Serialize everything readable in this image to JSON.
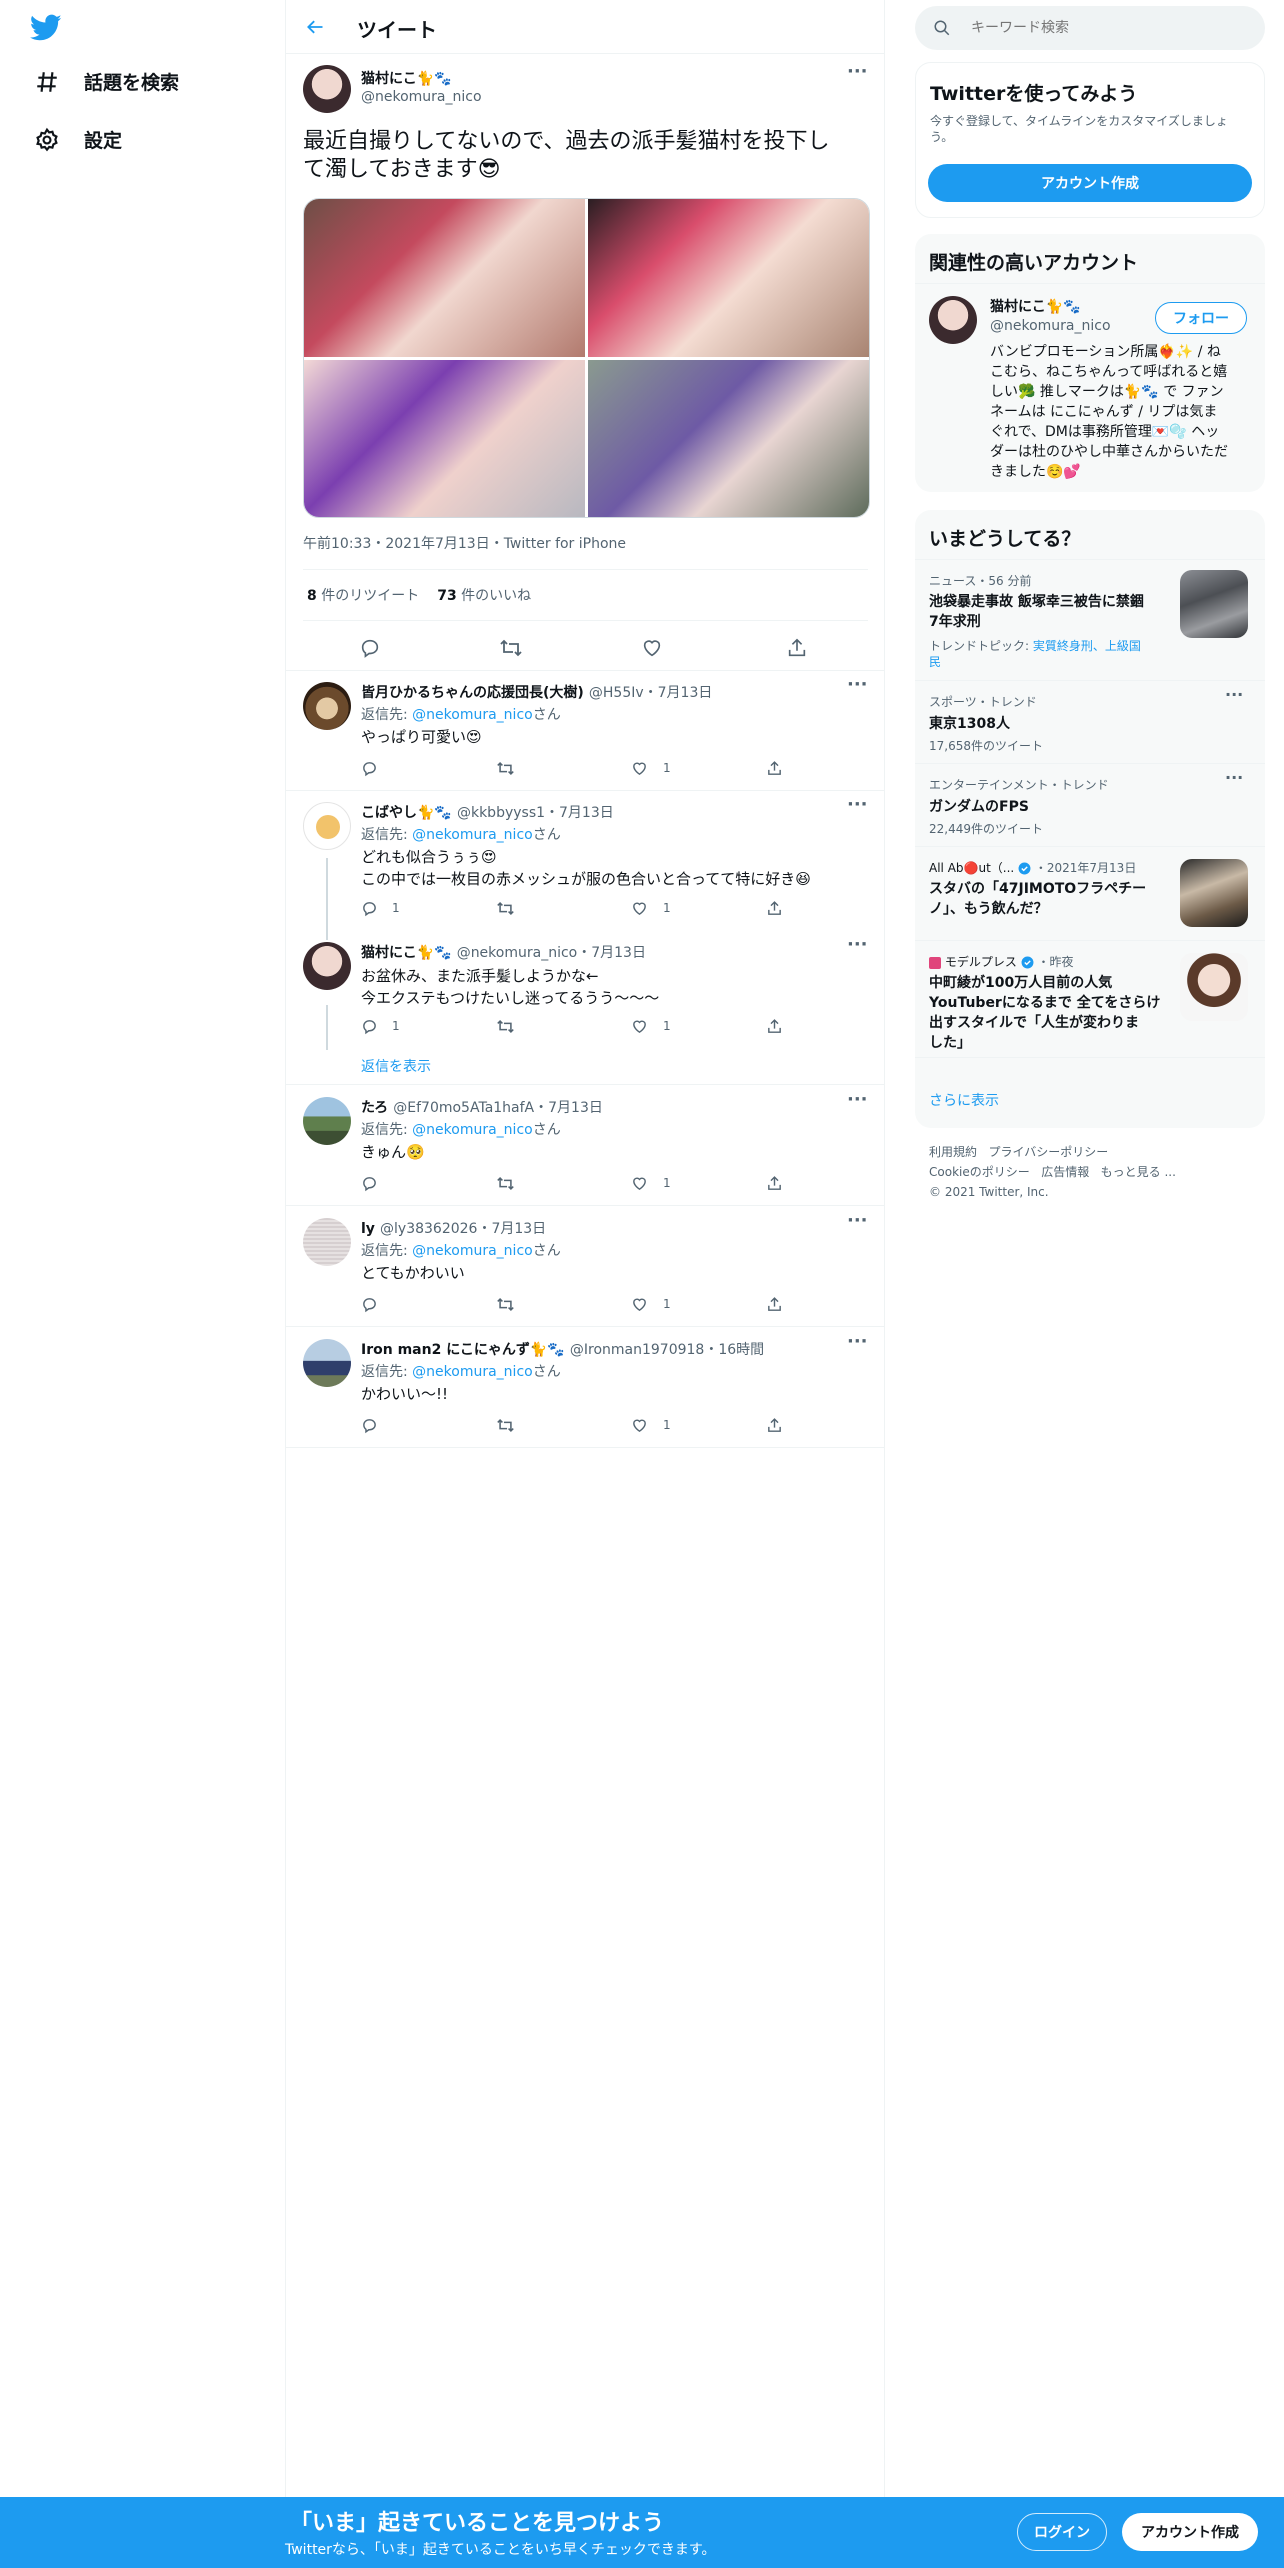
{
  "nav": {
    "explore_label": "話題を検索",
    "settings_label": "設定"
  },
  "header": {
    "title": "ツイート"
  },
  "main_tweet": {
    "author_name": "猫村にこ🐈🐾",
    "author_handle": "@nekomura_nico",
    "text_line1": "最近自撮りしてないので、過去の派手髪猫村を投下し",
    "text_line2": "て濁しておきます😎",
    "timestamp": "午前10:33・2021年7月13日・Twitter for iPhone",
    "retweet_count": "8",
    "retweet_label": "件のリツイート",
    "like_count": "73",
    "like_label": "件のいいね"
  },
  "replies": [
    {
      "name": "皆月ひかるちゃんの応援団長(大樹)",
      "meta": "@H55Iv・7月13日",
      "reply_prefix": "返信先: ",
      "reply_to": "@nekomura_nico",
      "reply_suffix": "さん",
      "text1": "やっぱり可愛い😍",
      "text2": "",
      "reply_count": "",
      "retweet_count": "",
      "like_count": "1"
    },
    {
      "name": "こばやし🐈🐾",
      "meta": "@kkbbyyss1・7月13日",
      "reply_prefix": "返信先: ",
      "reply_to": "@nekomura_nico",
      "reply_suffix": "さん",
      "text1": "どれも似合うぅぅ😍",
      "text2": "この中では一枚目の赤メッシュが服の色合いと合ってて特に好き😆",
      "reply_count": "1",
      "retweet_count": "",
      "like_count": "1"
    },
    {
      "name": "猫村にこ🐈🐾",
      "meta": "@nekomura_nico・7月13日",
      "reply_prefix": "",
      "reply_to": "",
      "reply_suffix": "",
      "text1": "お盆休み、また派手髪しようかな←",
      "text2": "今エクステもつけたいし迷ってるうう～～～",
      "reply_count": "1",
      "retweet_count": "",
      "like_count": "1"
    },
    {
      "name": "たろ",
      "meta": "@Ef70mo5ATa1hafA・7月13日",
      "reply_prefix": "返信先: ",
      "reply_to": "@nekomura_nico",
      "reply_suffix": "さん",
      "text1": "きゅん🥺",
      "text2": "",
      "reply_count": "",
      "retweet_count": "",
      "like_count": "1"
    },
    {
      "name": "ly",
      "meta": "@ly38362026・7月13日",
      "reply_prefix": "返信先: ",
      "reply_to": "@nekomura_nico",
      "reply_suffix": "さん",
      "text1": "とてもかわいい",
      "text2": "",
      "reply_count": "",
      "retweet_count": "",
      "like_count": "1"
    },
    {
      "name": "Iron man2 にこにゃんず🐈🐾",
      "meta": "@Ironman1970918・16時間",
      "reply_prefix": "返信先: ",
      "reply_to": "@nekomura_nico",
      "reply_suffix": "さん",
      "text1": "かわいい〜!!",
      "text2": "",
      "reply_count": "",
      "retweet_count": "",
      "like_count": "1"
    }
  ],
  "show_replies_label": "返信を表示",
  "search": {
    "placeholder": "キーワード検索"
  },
  "signup_card": {
    "title": "Twitterを使ってみよう",
    "desc1": "今すぐ登録して、タイムラインをカスタマイズしましょ",
    "desc2": "う。",
    "button": "アカウント作成"
  },
  "related": {
    "title": "関連性の高いアカウント",
    "name": "猫村にこ🐈🐾",
    "handle": "@nekomura_nico",
    "follow": "フォロー",
    "bio": [
      "バンビプロモーション所属❤️‍🔥✨ / ね",
      "こむら、ねこちゃんって呼ばれると嬉",
      "しい🥦 推しマークは🐈🐾 で ファン",
      "ネームは にこにゃんず / リプは気ま",
      "ぐれで、DMは事務所管理💌🫧 ヘッ",
      "ダーは杜のひやし中華さんからいただ",
      "きました☺️💕"
    ]
  },
  "trends": {
    "title": "いまどうしてる？",
    "items": [
      {
        "meta": "ニュース・56 分前",
        "title1": "池袋暴走事故 飯塚幸三被告に禁錮",
        "title2": "7年求刑",
        "topic_prefix": "トレンドトピック: ",
        "topic1": "実質終身刑、上級国",
        "topic2": "民"
      },
      {
        "meta": "スポーツ・トレンド",
        "title1": "東京1308人",
        "count": "17,658件のツイート"
      },
      {
        "meta": "エンターテインメント・トレンド",
        "title1": "ガンダムのFPS",
        "count": "22,449件のツイート"
      },
      {
        "source": "All Ab🔴ut（...",
        "meta": "・2021年7月13日",
        "title1": "スタバの「47JIMOTOフラペチー",
        "title2": "ノ」、もう飲んだ？"
      },
      {
        "source": "モデルプレス",
        "meta": "・昨夜",
        "title1": "中町綾が100万人目前の人気",
        "title2": "YouTuberになるまで 全てをさらけ",
        "title3": "出すスタイルで「人生が変わりま",
        "title4": "した」"
      }
    ],
    "show_more": "さらに表示"
  },
  "footer": {
    "terms": "利用規約",
    "privacy": "プライバシーポリシー",
    "cookie": "Cookieのポリシー",
    "ads": "広告情報",
    "more": "もっと見る ...",
    "copyright": "© 2021 Twitter, Inc."
  },
  "bottom_bar": {
    "title": "「いま」起きていることを見つけよう",
    "subtitle": "Twitterなら、「いま」起きていることをいち早くチェックできます。",
    "login": "ログイン",
    "signup": "アカウント作成"
  },
  "colors": {
    "accent": "#1d9bf0",
    "text": "#0f1419",
    "muted": "#536471",
    "border": "#eff3f4"
  }
}
